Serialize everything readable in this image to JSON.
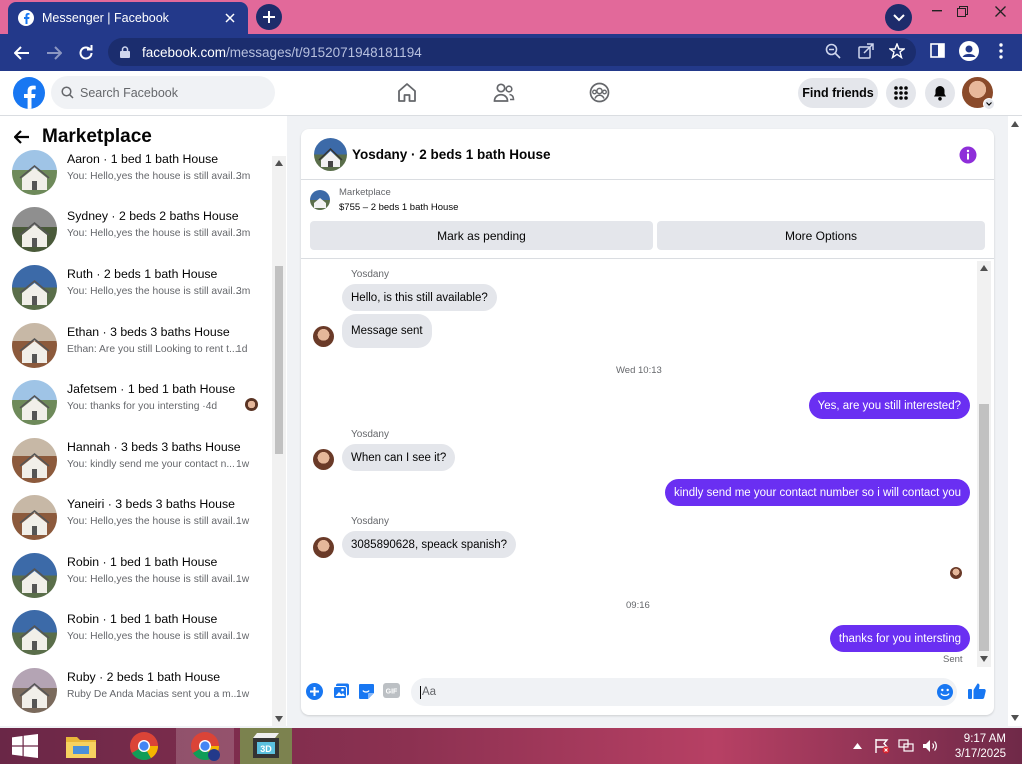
{
  "browser": {
    "tab_title": "Messenger | Facebook",
    "url_host": "facebook.com",
    "url_path": "/messages/t/9152071948181194"
  },
  "fb": {
    "search_placeholder": "Search Facebook",
    "find_friends": "Find friends"
  },
  "sidebar": {
    "title": "Marketplace",
    "conversations": [
      {
        "name": "Aaron · 1 bed 1 bath House",
        "preview": "You: Hello,yes the house is still avail...",
        "time": "3m",
        "thumb": "house-a"
      },
      {
        "name": "Sydney · 2 beds 2 baths House",
        "preview": "You: Hello,yes the house is still avail...",
        "time": "3m",
        "thumb": "house-d"
      },
      {
        "name": "Ruth · 2 beds 1 bath House",
        "preview": "You: Hello,yes the house is still avail...",
        "time": "3m",
        "thumb": "house-c"
      },
      {
        "name": "Ethan · 3 beds 3 baths House",
        "preview": "Ethan: Are you still Looking to rent t...",
        "time": "1d",
        "thumb": "house-b"
      },
      {
        "name": "Jafetsem · 1 bed 1 bath House",
        "preview": "You: thanks for you intersting ·4d",
        "time": "",
        "thumb": "house-a"
      },
      {
        "name": "Hannah · 3 beds 3 baths House",
        "preview": "You: kindly send me your contact n...",
        "time": "1w",
        "thumb": "house-b"
      },
      {
        "name": "Yaneiri · 3 beds 3 baths House",
        "preview": "You: Hello,yes the house is still avail...",
        "time": "1w",
        "thumb": "house-b"
      },
      {
        "name": "Robin · 1 bed 1 bath House",
        "preview": "You: Hello,yes the house is still avail...",
        "time": "1w",
        "thumb": "house-c"
      },
      {
        "name": "Robin · 1 bed 1 bath House",
        "preview": "You: Hello,yes the house is still avail...",
        "time": "1w",
        "thumb": "house-c"
      },
      {
        "name": "Ruby · 2 beds 1 bath House",
        "preview": "Ruby De Anda Macias sent you a m...",
        "time": "1w",
        "thumb": "house-e"
      }
    ]
  },
  "chat": {
    "title": "Yosdany · 2 beds 1 bath House",
    "marketplace_label": "Marketplace",
    "listing": "$755 – 2 beds 1 bath House",
    "mark_pending": "Mark as pending",
    "more_options": "More Options",
    "sender": "Yosdany",
    "messages": {
      "m1": "Hello, is this still available?",
      "m2": "Message sent",
      "ts1": "Wed 10:13",
      "m3": "Yes, are you still interested?",
      "m4": "When can I see it?",
      "m5": "kindly send me your contact number so i will contact you",
      "m6": "3085890628, speack spanish?",
      "ts2": "09:16",
      "m7": "thanks for you intersting",
      "status": "Sent"
    },
    "composer_placeholder": "Aa"
  },
  "taskbar": {
    "time": "9:17 AM",
    "date": "3/17/2025"
  },
  "colors": {
    "accent": "#1877f2",
    "outgoing_bubble": "#6a2ff2",
    "browser_frame": "#23398a",
    "titlebar": "#e2699a"
  }
}
